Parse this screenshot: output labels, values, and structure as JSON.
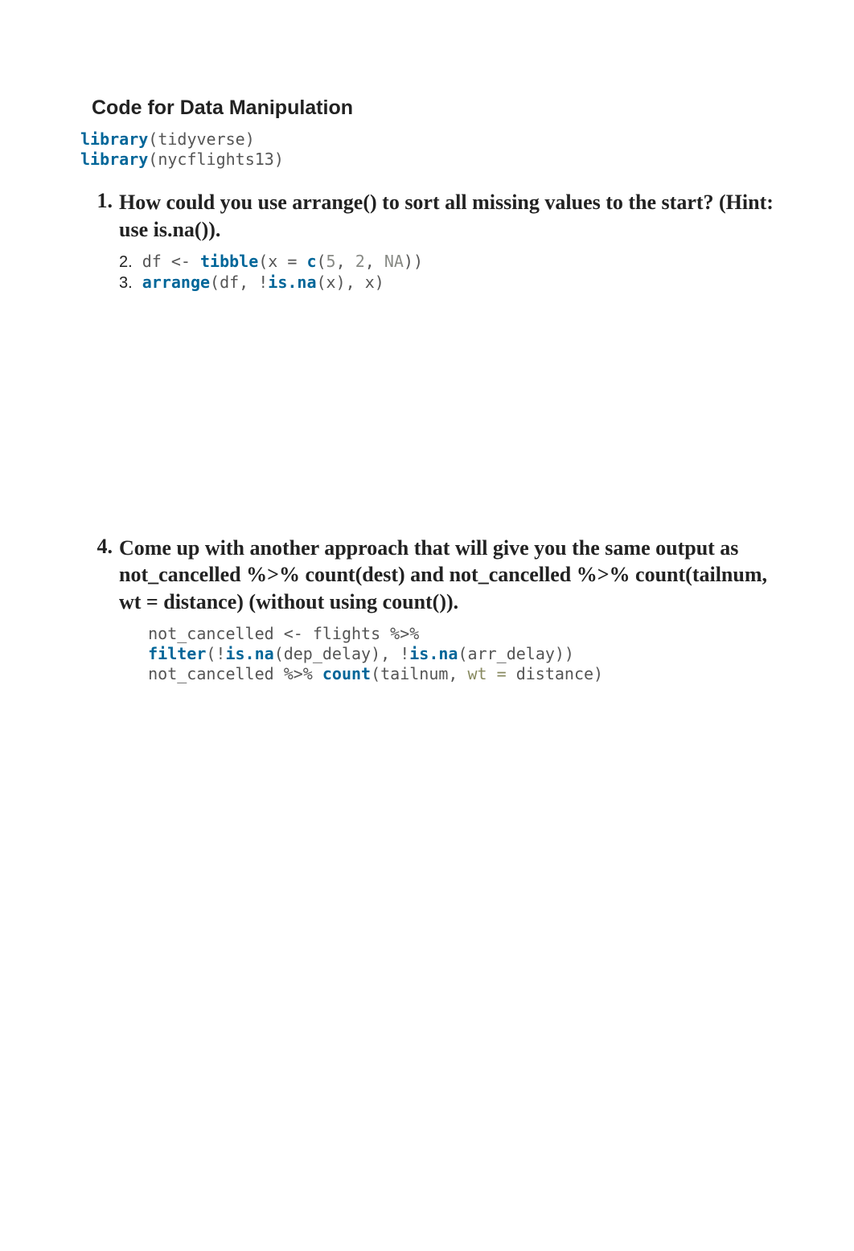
{
  "title": "Code for Data Manipulation",
  "library_block": {
    "lines": [
      {
        "fn": "library",
        "arg": "(tidyverse)"
      },
      {
        "fn": "library",
        "arg": "(nycflights13)"
      }
    ]
  },
  "q1": {
    "number": "1.",
    "text": "How could you use arrange() to sort all missing values to the start? (Hint: use is.na()).",
    "code_lines": [
      {
        "marker": "2.",
        "tokens": [
          {
            "t": " df <- ",
            "c": "plain"
          },
          {
            "t": "tibble",
            "c": "kw-bold"
          },
          {
            "t": "(x = ",
            "c": "plain"
          },
          {
            "t": "c",
            "c": "kw-bold"
          },
          {
            "t": "(",
            "c": "plain"
          },
          {
            "t": "5",
            "c": "num-lit"
          },
          {
            "t": ", ",
            "c": "plain"
          },
          {
            "t": "2",
            "c": "num-lit"
          },
          {
            "t": ", ",
            "c": "plain"
          },
          {
            "t": "NA",
            "c": "na-lit"
          },
          {
            "t": "))",
            "c": "plain"
          }
        ]
      },
      {
        "marker": "3.",
        "tokens": [
          {
            "t": " ",
            "c": "plain"
          },
          {
            "t": "arrange",
            "c": "kw-bold"
          },
          {
            "t": "(df, !",
            "c": "plain"
          },
          {
            "t": "is.na",
            "c": "kw-bold"
          },
          {
            "t": "(x), x)",
            "c": "plain"
          }
        ]
      }
    ]
  },
  "q4": {
    "number": "4.",
    "text": "Come up with another approach that will give you the same output as not_cancelled %>% count(dest) and not_cancelled %>% count(tailnum, wt = distance) (without using count()).",
    "code_lines": [
      {
        "tokens": [
          {
            "t": "not_cancelled <- flights %>%",
            "c": "plain"
          }
        ]
      },
      {
        "tokens": [
          {
            "t": "filter",
            "c": "kw-bold"
          },
          {
            "t": "(!",
            "c": "plain"
          },
          {
            "t": "is.na",
            "c": "kw-bold"
          },
          {
            "t": "(dep_delay), !",
            "c": "plain"
          },
          {
            "t": "is.na",
            "c": "kw-bold"
          },
          {
            "t": "(arr_delay))",
            "c": "plain"
          }
        ]
      },
      {
        "tokens": [
          {
            "t": "not_cancelled %>% ",
            "c": "plain"
          },
          {
            "t": "count",
            "c": "kw-bold"
          },
          {
            "t": "(tailnum, ",
            "c": "plain"
          },
          {
            "t": "wt =",
            "c": "named-arg"
          },
          {
            "t": " distance)",
            "c": "plain"
          }
        ]
      }
    ]
  }
}
